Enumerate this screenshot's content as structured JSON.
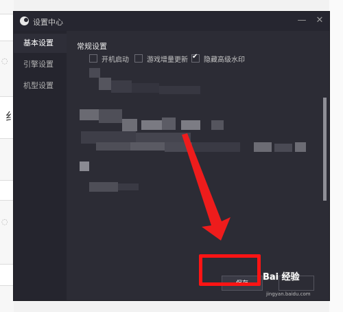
{
  "window": {
    "title": "设置中心",
    "minimize_glyph": "—",
    "close_glyph": "✕"
  },
  "sidebar": {
    "items": [
      {
        "label": "基本设置",
        "active": true
      },
      {
        "label": "引擎设置",
        "active": false
      },
      {
        "label": "机型设置",
        "active": false
      }
    ]
  },
  "general": {
    "section_title": "常规设置",
    "options": [
      {
        "label": "开机启动",
        "checked": false
      },
      {
        "label": "游戏增量更新",
        "checked": false
      },
      {
        "label": "隐藏高级水印",
        "checked": true
      }
    ]
  },
  "footer": {
    "save_label": "保存"
  },
  "background": {
    "partial_char": "纟"
  },
  "watermark": {
    "brand": "Bai 经验",
    "url": "jingyan.baidu.com"
  },
  "colors": {
    "accent": "#ff1414",
    "dialog_bg": "#2c2c35"
  }
}
